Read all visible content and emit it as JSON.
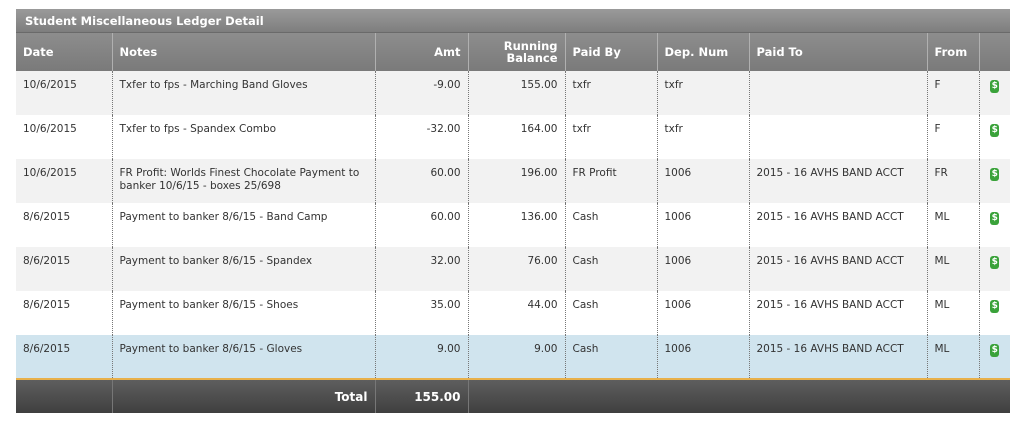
{
  "ledger": {
    "title": "Student Miscellaneous Ledger Detail",
    "columns": {
      "date": "Date",
      "notes": "Notes",
      "amt": "Amt",
      "running_balance_1": "Running",
      "running_balance_2": "Balance",
      "paid_by": "Paid By",
      "dep_num": "Dep. Num",
      "paid_to": "Paid To",
      "from": "From"
    },
    "rows": [
      {
        "date": "10/6/2015",
        "notes": "Txfer to fps - Marching Band Gloves",
        "amt": "-9.00",
        "balance": "155.00",
        "paid_by": "txfr",
        "dep_num": "txfr",
        "paid_to": "",
        "from": "F",
        "icon": "$"
      },
      {
        "date": "10/6/2015",
        "notes": "Txfer to fps - Spandex Combo",
        "amt": "-32.00",
        "balance": "164.00",
        "paid_by": "txfr",
        "dep_num": "txfr",
        "paid_to": "",
        "from": "F",
        "icon": "$"
      },
      {
        "date": "10/6/2015",
        "notes": "FR Profit: Worlds Finest Chocolate Payment to banker 10/6/15 - boxes 25/698",
        "amt": "60.00",
        "balance": "196.00",
        "paid_by": "FR Profit",
        "dep_num": "1006",
        "paid_to": "2015 - 16 AVHS BAND ACCT",
        "from": "FR",
        "icon": "$"
      },
      {
        "date": "8/6/2015",
        "notes": "Payment to banker 8/6/15 - Band Camp",
        "amt": "60.00",
        "balance": "136.00",
        "paid_by": "Cash",
        "dep_num": "1006",
        "paid_to": "2015 - 16 AVHS BAND ACCT",
        "from": "ML",
        "icon": "$"
      },
      {
        "date": "8/6/2015",
        "notes": "Payment to banker 8/6/15 - Spandex",
        "amt": "32.00",
        "balance": "76.00",
        "paid_by": "Cash",
        "dep_num": "1006",
        "paid_to": "2015 - 16 AVHS BAND ACCT",
        "from": "ML",
        "icon": "$"
      },
      {
        "date": "8/6/2015",
        "notes": "Payment to banker 8/6/15 - Shoes",
        "amt": "35.00",
        "balance": "44.00",
        "paid_by": "Cash",
        "dep_num": "1006",
        "paid_to": "2015 - 16 AVHS BAND ACCT",
        "from": "ML",
        "icon": "$"
      },
      {
        "date": "8/6/2015",
        "notes": "Payment to banker 8/6/15 - Gloves",
        "amt": "9.00",
        "balance": "9.00",
        "paid_by": "Cash",
        "dep_num": "1006",
        "paid_to": "2015 - 16 AVHS BAND ACCT",
        "from": "ML",
        "icon": "$"
      }
    ],
    "footer": {
      "total_label": "Total",
      "total_value": "155.00"
    },
    "colors": {
      "header": "#8a8a8a",
      "footer": "#4a4a4a",
      "selected_row": "#d0e4ee",
      "accent": "#e8b04a",
      "icon": "#3aa23a"
    }
  }
}
